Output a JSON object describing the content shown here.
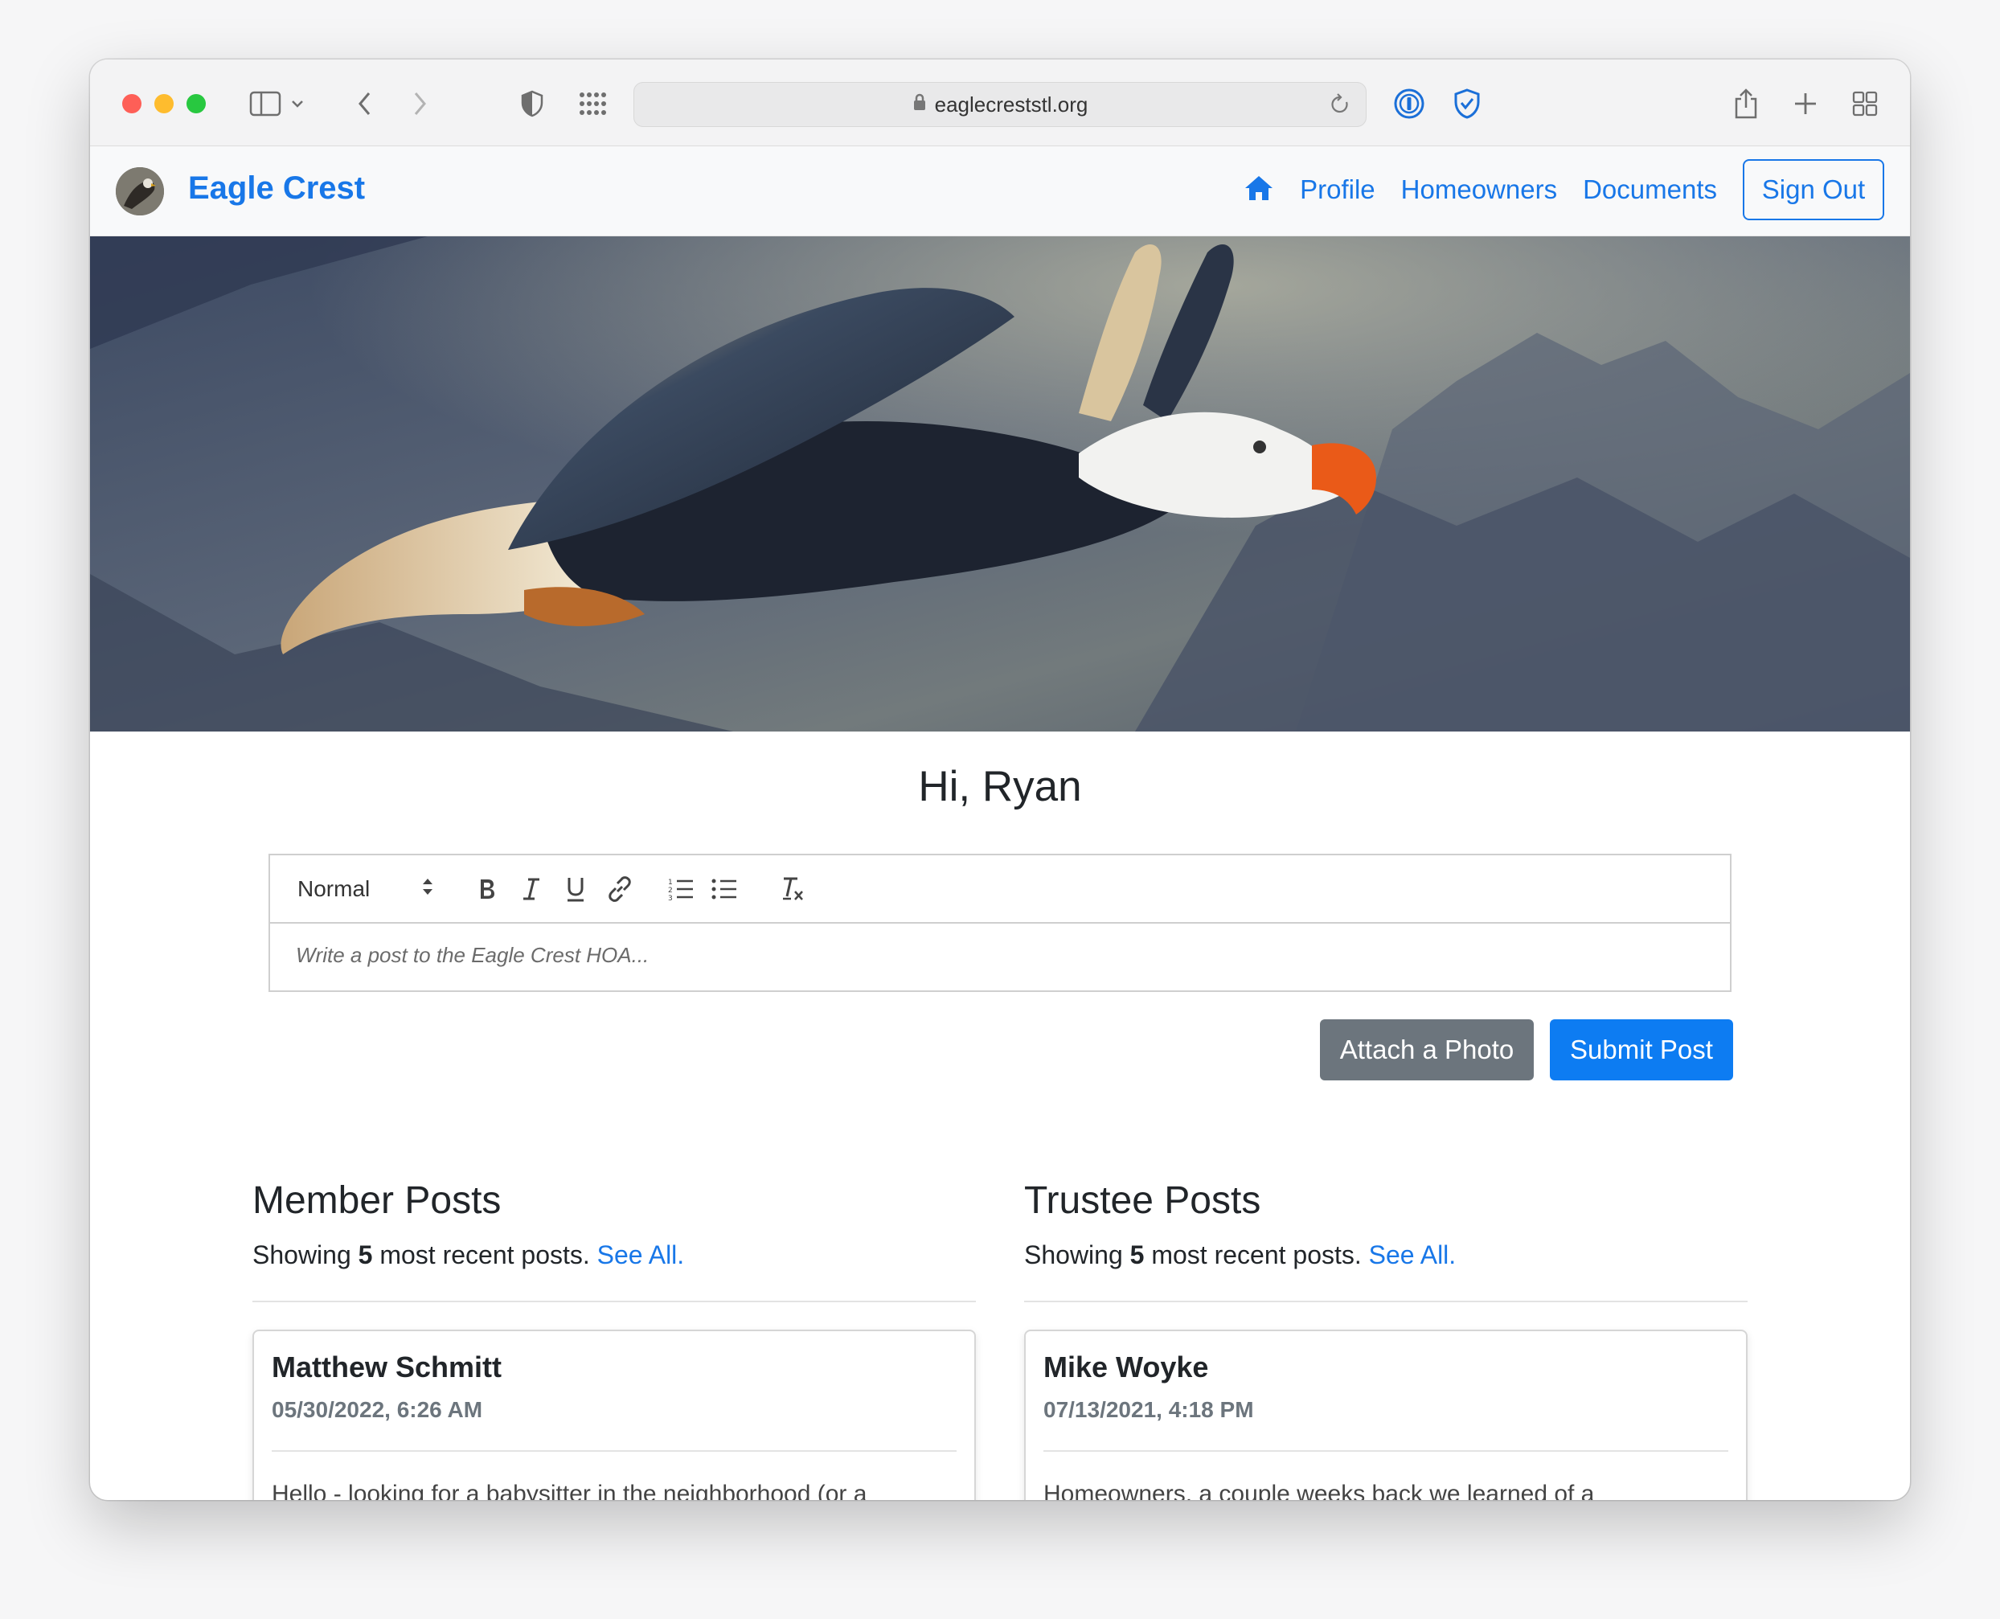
{
  "browser": {
    "url": "eaglecreststl.org"
  },
  "site": {
    "brand": "Eagle Crest",
    "nav": {
      "profile": "Profile",
      "homeowners": "Homeowners",
      "documents": "Documents",
      "sign_out": "Sign Out"
    }
  },
  "greeting": "Hi, Ryan",
  "editor": {
    "format_value": "Normal",
    "placeholder": "Write a post to the Eagle Crest HOA..."
  },
  "actions": {
    "attach_photo": "Attach a Photo",
    "submit_post": "Submit Post"
  },
  "member_posts": {
    "title": "Member Posts",
    "showing_prefix": "Showing",
    "count": "5",
    "showing_suffix": "most recent posts.",
    "see_all": "See All.",
    "first_post": {
      "author": "Matthew Schmitt",
      "date": "05/30/2022, 6:26 AM",
      "body_preview": "Hello - looking for a babysitter in the neighborhood (or a"
    }
  },
  "trustee_posts": {
    "title": "Trustee Posts",
    "showing_prefix": "Showing",
    "count": "5",
    "showing_suffix": "most recent posts.",
    "see_all": "See All.",
    "first_post": {
      "author": "Mike Woyke",
      "date": "07/13/2021, 4:18 PM",
      "body_preview": "Homeowners, a couple weeks back we learned of a"
    }
  },
  "colors": {
    "link": "#1877e8",
    "primary_button": "#0d7cf2",
    "secondary_button": "#6c757d"
  }
}
